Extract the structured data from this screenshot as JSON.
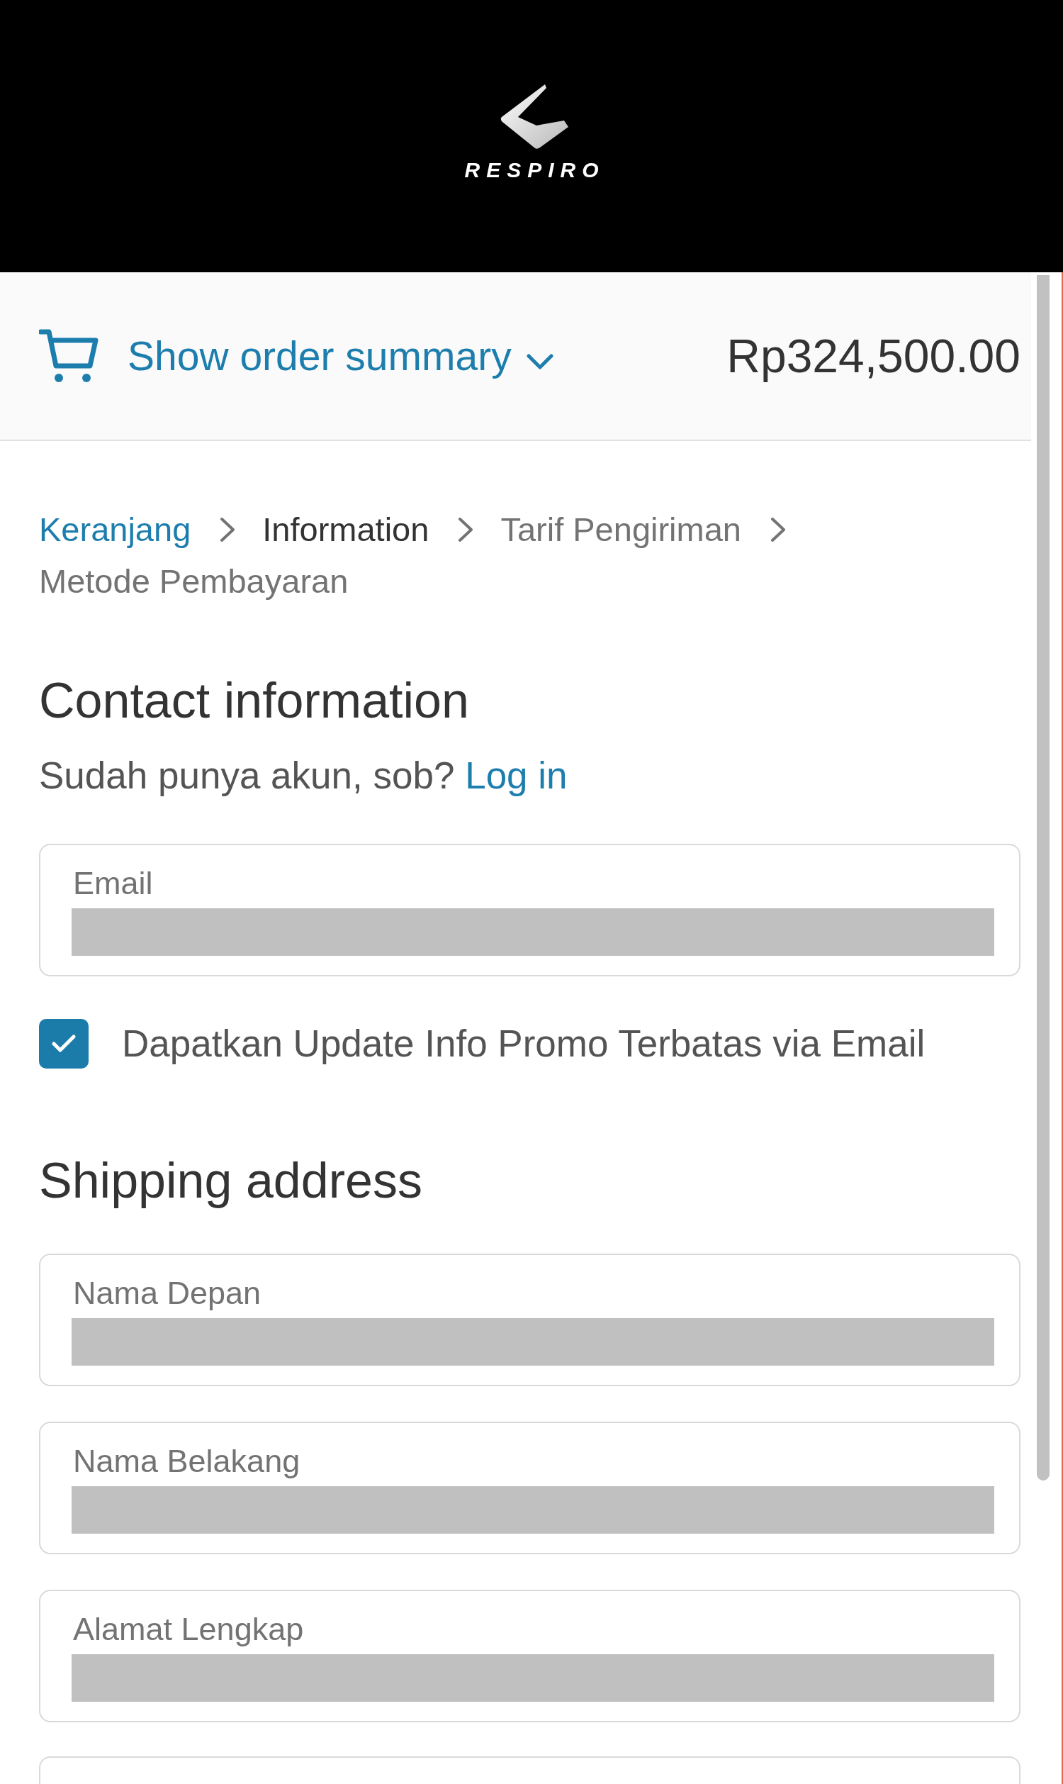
{
  "header": {
    "logo_text": "RESPIRO"
  },
  "order_summary": {
    "toggle_label": "Show order summary",
    "expanded": false,
    "total": "Rp324,500.00"
  },
  "breadcrumbs": [
    {
      "label": "Keranjang",
      "kind": "link"
    },
    {
      "label": "Information",
      "kind": "current"
    },
    {
      "label": "Tarif Pengiriman",
      "kind": "upcoming"
    },
    {
      "label": "Metode Pembayaran",
      "kind": "upcoming"
    }
  ],
  "contact": {
    "title": "Contact information",
    "prompt": "Sudah punya akun, sob?",
    "login_link": "Log in",
    "email_field": {
      "label": "Email"
    },
    "newsletter": {
      "label": "Dapatkan Update Info Promo Terbatas via Email",
      "checked": true
    }
  },
  "shipping": {
    "title": "Shipping address",
    "fields": [
      {
        "kind": "labeled",
        "label": "Nama Depan"
      },
      {
        "kind": "labeled",
        "label": "Nama Belakang"
      },
      {
        "kind": "labeled",
        "label": "Alamat Lengkap"
      },
      {
        "kind": "partial"
      }
    ]
  }
}
